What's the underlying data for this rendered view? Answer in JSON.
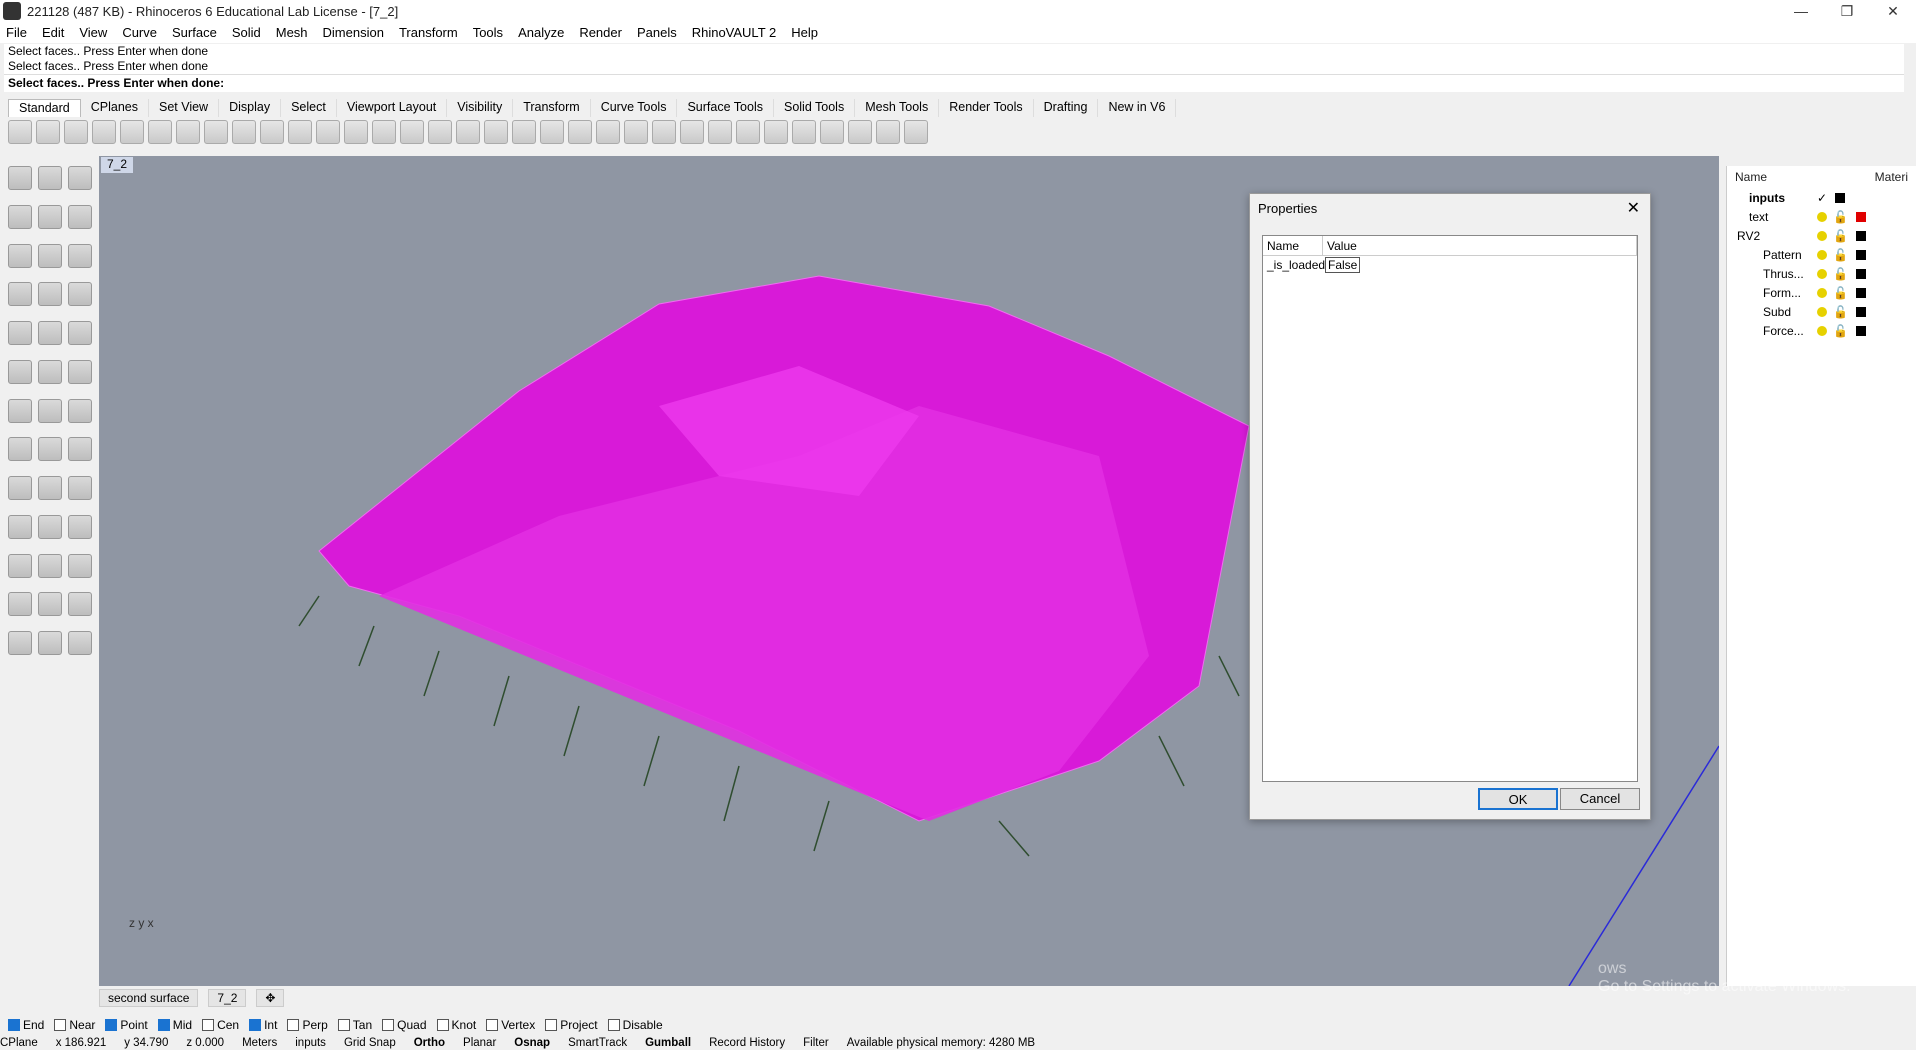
{
  "window": {
    "title": "221128 (487 KB) - Rhinoceros 6 Educational Lab License - [7_2]",
    "controls": [
      "—",
      "❐",
      "✕"
    ]
  },
  "menu": [
    "File",
    "Edit",
    "View",
    "Curve",
    "Surface",
    "Solid",
    "Mesh",
    "Dimension",
    "Transform",
    "Tools",
    "Analyze",
    "Render",
    "Panels",
    "RhinoVAULT 2",
    "Help"
  ],
  "command": {
    "history": [
      "Select faces.. Press Enter when done",
      "Select faces.. Press Enter when done"
    ],
    "prompt": "Select faces.. Press Enter when done:"
  },
  "tabs": [
    "Standard",
    "CPlanes",
    "Set View",
    "Display",
    "Select",
    "Viewport Layout",
    "Visibility",
    "Transform",
    "Curve Tools",
    "Surface Tools",
    "Solid Tools",
    "Mesh Tools",
    "Render Tools",
    "Drafting",
    "New in V6"
  ],
  "viewport": {
    "name": "7_2",
    "axes": "z y x"
  },
  "dialog": {
    "title": "Properties",
    "col_name": "Name",
    "col_value": "Value",
    "row_name": "_is_loaded",
    "row_value": "False",
    "ok": "OK",
    "cancel": "Cancel"
  },
  "layers": {
    "header_name": "Name",
    "header_mat": "Materi",
    "items": [
      "inputs",
      "text",
      "RV2",
      "Pattern",
      "Thrus...",
      "Form...",
      "Subd",
      "Force..."
    ]
  },
  "bottom_tabs": [
    "second surface",
    "7_2"
  ],
  "osnap": [
    {
      "label": "End",
      "on": true
    },
    {
      "label": "Near",
      "on": false
    },
    {
      "label": "Point",
      "on": true
    },
    {
      "label": "Mid",
      "on": true
    },
    {
      "label": "Cen",
      "on": false
    },
    {
      "label": "Int",
      "on": true
    },
    {
      "label": "Perp",
      "on": false
    },
    {
      "label": "Tan",
      "on": false
    },
    {
      "label": "Quad",
      "on": false
    },
    {
      "label": "Knot",
      "on": false
    },
    {
      "label": "Vertex",
      "on": false
    },
    {
      "label": "Project",
      "on": false
    },
    {
      "label": "Disable",
      "on": false
    }
  ],
  "status": [
    "CPlane",
    "x 186.921",
    "y 34.790",
    "z 0.000",
    "Meters",
    "inputs",
    "Grid Snap",
    "Ortho",
    "Planar",
    "Osnap",
    "SmartTrack",
    "Gumball",
    "Record History",
    "Filter",
    "Available physical memory: 4280 MB"
  ],
  "watermark": [
    "ows",
    "Go to Settings to activate Windows."
  ]
}
